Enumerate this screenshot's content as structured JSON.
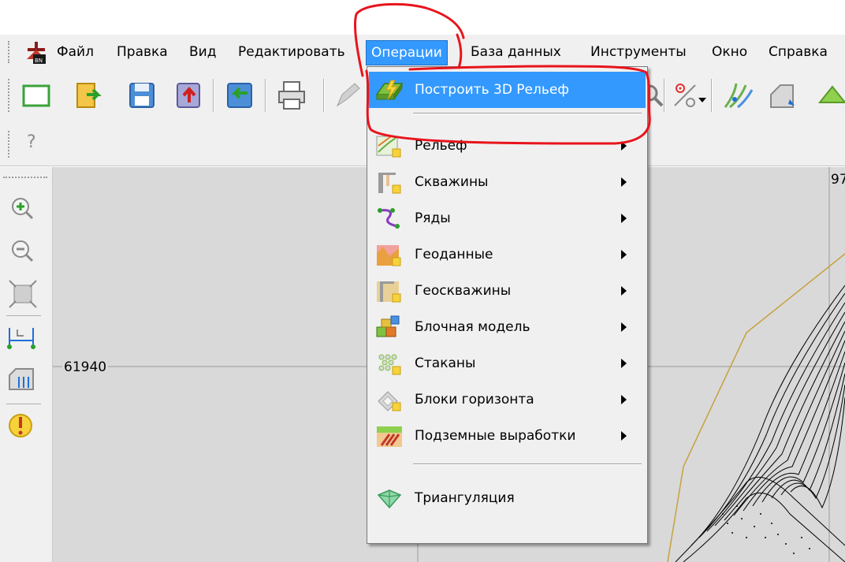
{
  "menubar": {
    "items": [
      "Файл",
      "Правка",
      "Вид",
      "Редактировать",
      "Операции",
      "База данных",
      "Инструменты",
      "Окно",
      "Справка"
    ],
    "active_index": 4
  },
  "toolbar2": {
    "help_label": "?"
  },
  "dropdown": {
    "top_item": "Построить 3D Рельеф",
    "items": [
      {
        "label": "Рельеф",
        "icon": "relief-icon",
        "submenu": true
      },
      {
        "label": "Скважины",
        "icon": "wells-icon",
        "submenu": true
      },
      {
        "label": "Ряды",
        "icon": "rows-icon",
        "submenu": true
      },
      {
        "label": "Геоданные",
        "icon": "geodata-icon",
        "submenu": true
      },
      {
        "label": "Геоскважины",
        "icon": "geowells-icon",
        "submenu": true
      },
      {
        "label": "Блочная модель",
        "icon": "block-model-icon",
        "submenu": true
      },
      {
        "label": "Стаканы",
        "icon": "cups-icon",
        "submenu": true
      },
      {
        "label": "Блоки горизонта",
        "icon": "horizon-blocks-icon",
        "submenu": true
      },
      {
        "label": "Подземные выработки",
        "icon": "underground-workings-icon",
        "submenu": true
      }
    ],
    "bottom_item": "Триангуляция"
  },
  "canvas": {
    "grid_label_left": "61940",
    "grid_label_right": "97"
  },
  "colors": {
    "highlight": "#3399ff",
    "annotation": "#e8141c",
    "background": "#f0f0f0",
    "canvas": "#d9d9d9"
  }
}
